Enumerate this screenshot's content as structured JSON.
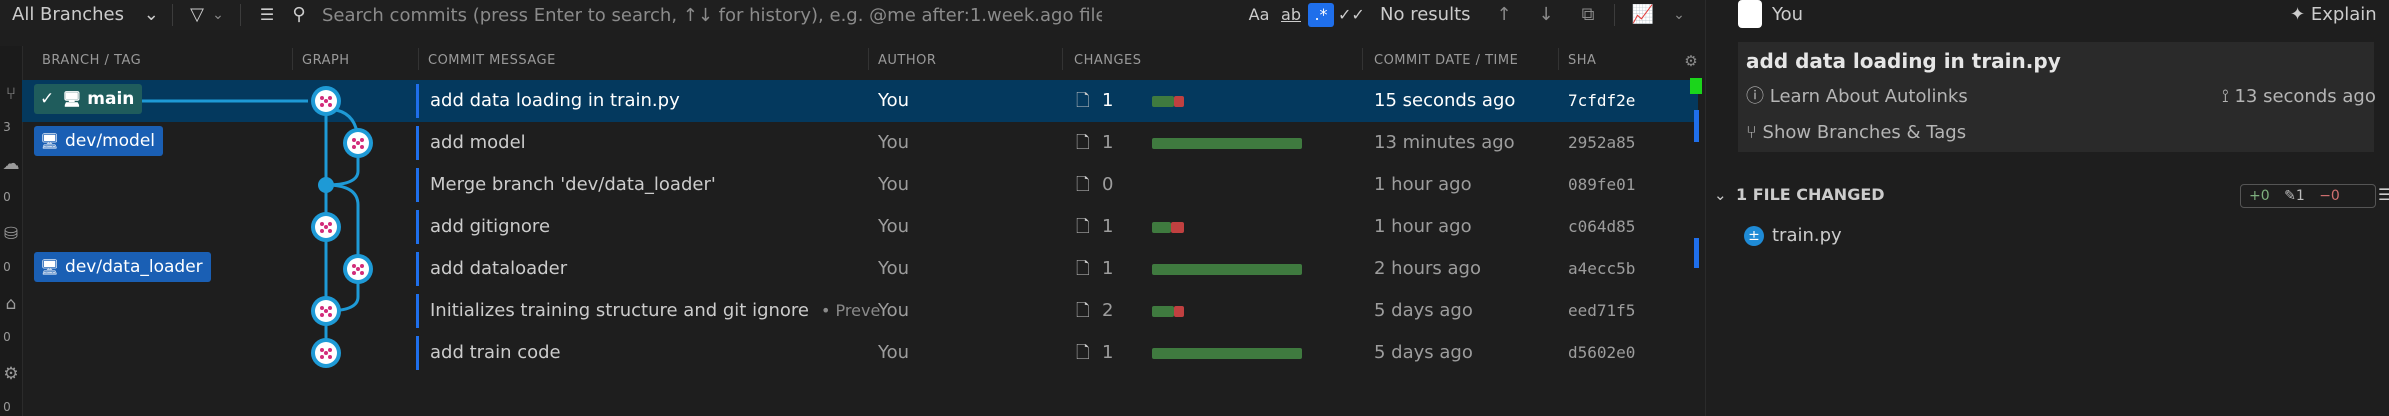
{
  "toolbar": {
    "branch_selector": "All Branches",
    "search_placeholder": "Search commits (press Enter to search, ↑↓ for history), e.g. @me after:1.week.ago file:*.ts",
    "match_case_label": "Aa",
    "whole_word_label": "ab",
    "regex_label": ".*",
    "results_text": "No results"
  },
  "rail": {
    "counts": [
      "3",
      "0",
      "0",
      "0",
      "0"
    ]
  },
  "columns": {
    "branch": "BRANCH / TAG",
    "graph": "GRAPH",
    "message": "COMMIT MESSAGE",
    "author": "AUTHOR",
    "changes": "CHANGES",
    "date": "COMMIT DATE / TIME",
    "sha": "SHA"
  },
  "branches": {
    "main": "main",
    "dev_model": "dev/model",
    "dev_data_loader": "dev/data_loader"
  },
  "commits": [
    {
      "message": "add data loading in train.py",
      "author": "You",
      "files": "1",
      "date": "15 seconds ago",
      "sha": "7cfdf2e",
      "add": 0.7,
      "del": 0.3
    },
    {
      "message": "add model",
      "author": "You",
      "files": "1",
      "date": "13 minutes ago",
      "sha": "2952a85",
      "add": 1.0,
      "del": 0.0
    },
    {
      "message": "Merge branch 'dev/data_loader'",
      "author": "You",
      "files": "0",
      "date": "1 hour ago",
      "sha": "089fe01",
      "add": 0.0,
      "del": 0.0
    },
    {
      "message": "add gitignore",
      "author": "You",
      "files": "1",
      "date": "1 hour ago",
      "sha": "c064d85",
      "add": 0.6,
      "del": 0.4
    },
    {
      "message": "add dataloader",
      "author": "You",
      "files": "1",
      "date": "2 hours ago",
      "sha": "a4ecc5b",
      "add": 1.0,
      "del": 0.0
    },
    {
      "message": "Initializes training structure and git ignore",
      "sub": "• Preven...",
      "author": "You",
      "files": "2",
      "date": "5 days ago",
      "sha": "eed71f5",
      "add": 0.7,
      "del": 0.3
    },
    {
      "message": "add train code",
      "author": "You",
      "files": "1",
      "date": "5 days ago",
      "sha": "d5602e0",
      "add": 1.0,
      "del": 0.0
    }
  ],
  "details": {
    "author": "You",
    "explain_label": "Explain",
    "commit_title": "add data loading in train.py",
    "autolinks_label": "Learn About Autolinks",
    "time_ago": "13 seconds ago",
    "branches_tags_label": "Show Branches & Tags",
    "files_changed_header": "1 FILE CHANGED",
    "stat_added": "+0",
    "stat_modified": "1",
    "stat_deleted": "−0",
    "file_name": "train.py"
  },
  "colors": {
    "selection": "#04395e",
    "branch_blue": "#1a5fb4",
    "graph_line": "#1e9ad6",
    "add_bar": "#3f7a3f",
    "del_bar": "#c04040"
  }
}
